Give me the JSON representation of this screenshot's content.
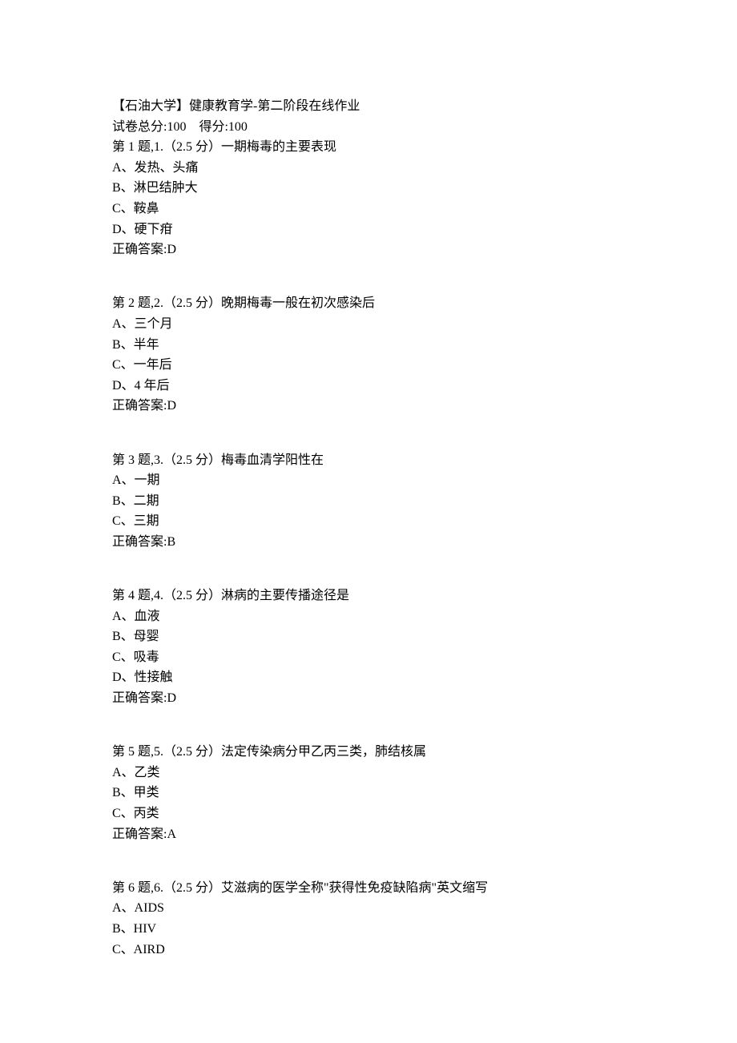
{
  "header": {
    "title": "【石油大学】健康教育学-第二阶段在线作业",
    "score_total_label": "试卷总分:100",
    "score_get_label": "得分:100"
  },
  "questions": [
    {
      "prefix": "第 1 题,1.（2.5 分）",
      "text": "一期梅毒的主要表现",
      "options": [
        "A、发热、头痛",
        "B、淋巴结肿大",
        "C、鞍鼻",
        "D、硬下疳"
      ],
      "answer_label": "正确答案:D"
    },
    {
      "prefix": "第 2 题,2.（2.5 分）",
      "text": "晚期梅毒一般在初次感染后",
      "options": [
        "A、三个月",
        "B、半年",
        "C、一年后",
        "D、4 年后"
      ],
      "answer_label": "正确答案:D"
    },
    {
      "prefix": "第 3 题,3.（2.5 分）",
      "text": "梅毒血清学阳性在",
      "options": [
        "A、一期",
        "B、二期",
        "C、三期"
      ],
      "answer_label": "正确答案:B"
    },
    {
      "prefix": "第 4 题,4.（2.5 分）",
      "text": "淋病的主要传播途径是",
      "options": [
        "A、血液",
        "B、母婴",
        "C、吸毒",
        "D、性接触"
      ],
      "answer_label": "正确答案:D"
    },
    {
      "prefix": "第 5 题,5.（2.5 分）",
      "text": "法定传染病分甲乙丙三类，肺结核属",
      "options": [
        "A、乙类",
        "B、甲类",
        "C、丙类"
      ],
      "answer_label": "正确答案:A"
    },
    {
      "prefix": "第 6 题,6.（2.5 分）",
      "text": "艾滋病的医学全称\"获得性免疫缺陷病\"英文缩写",
      "options": [
        "A、AIDS",
        "B、HIV",
        "C、AIRD"
      ],
      "answer_label": ""
    }
  ]
}
